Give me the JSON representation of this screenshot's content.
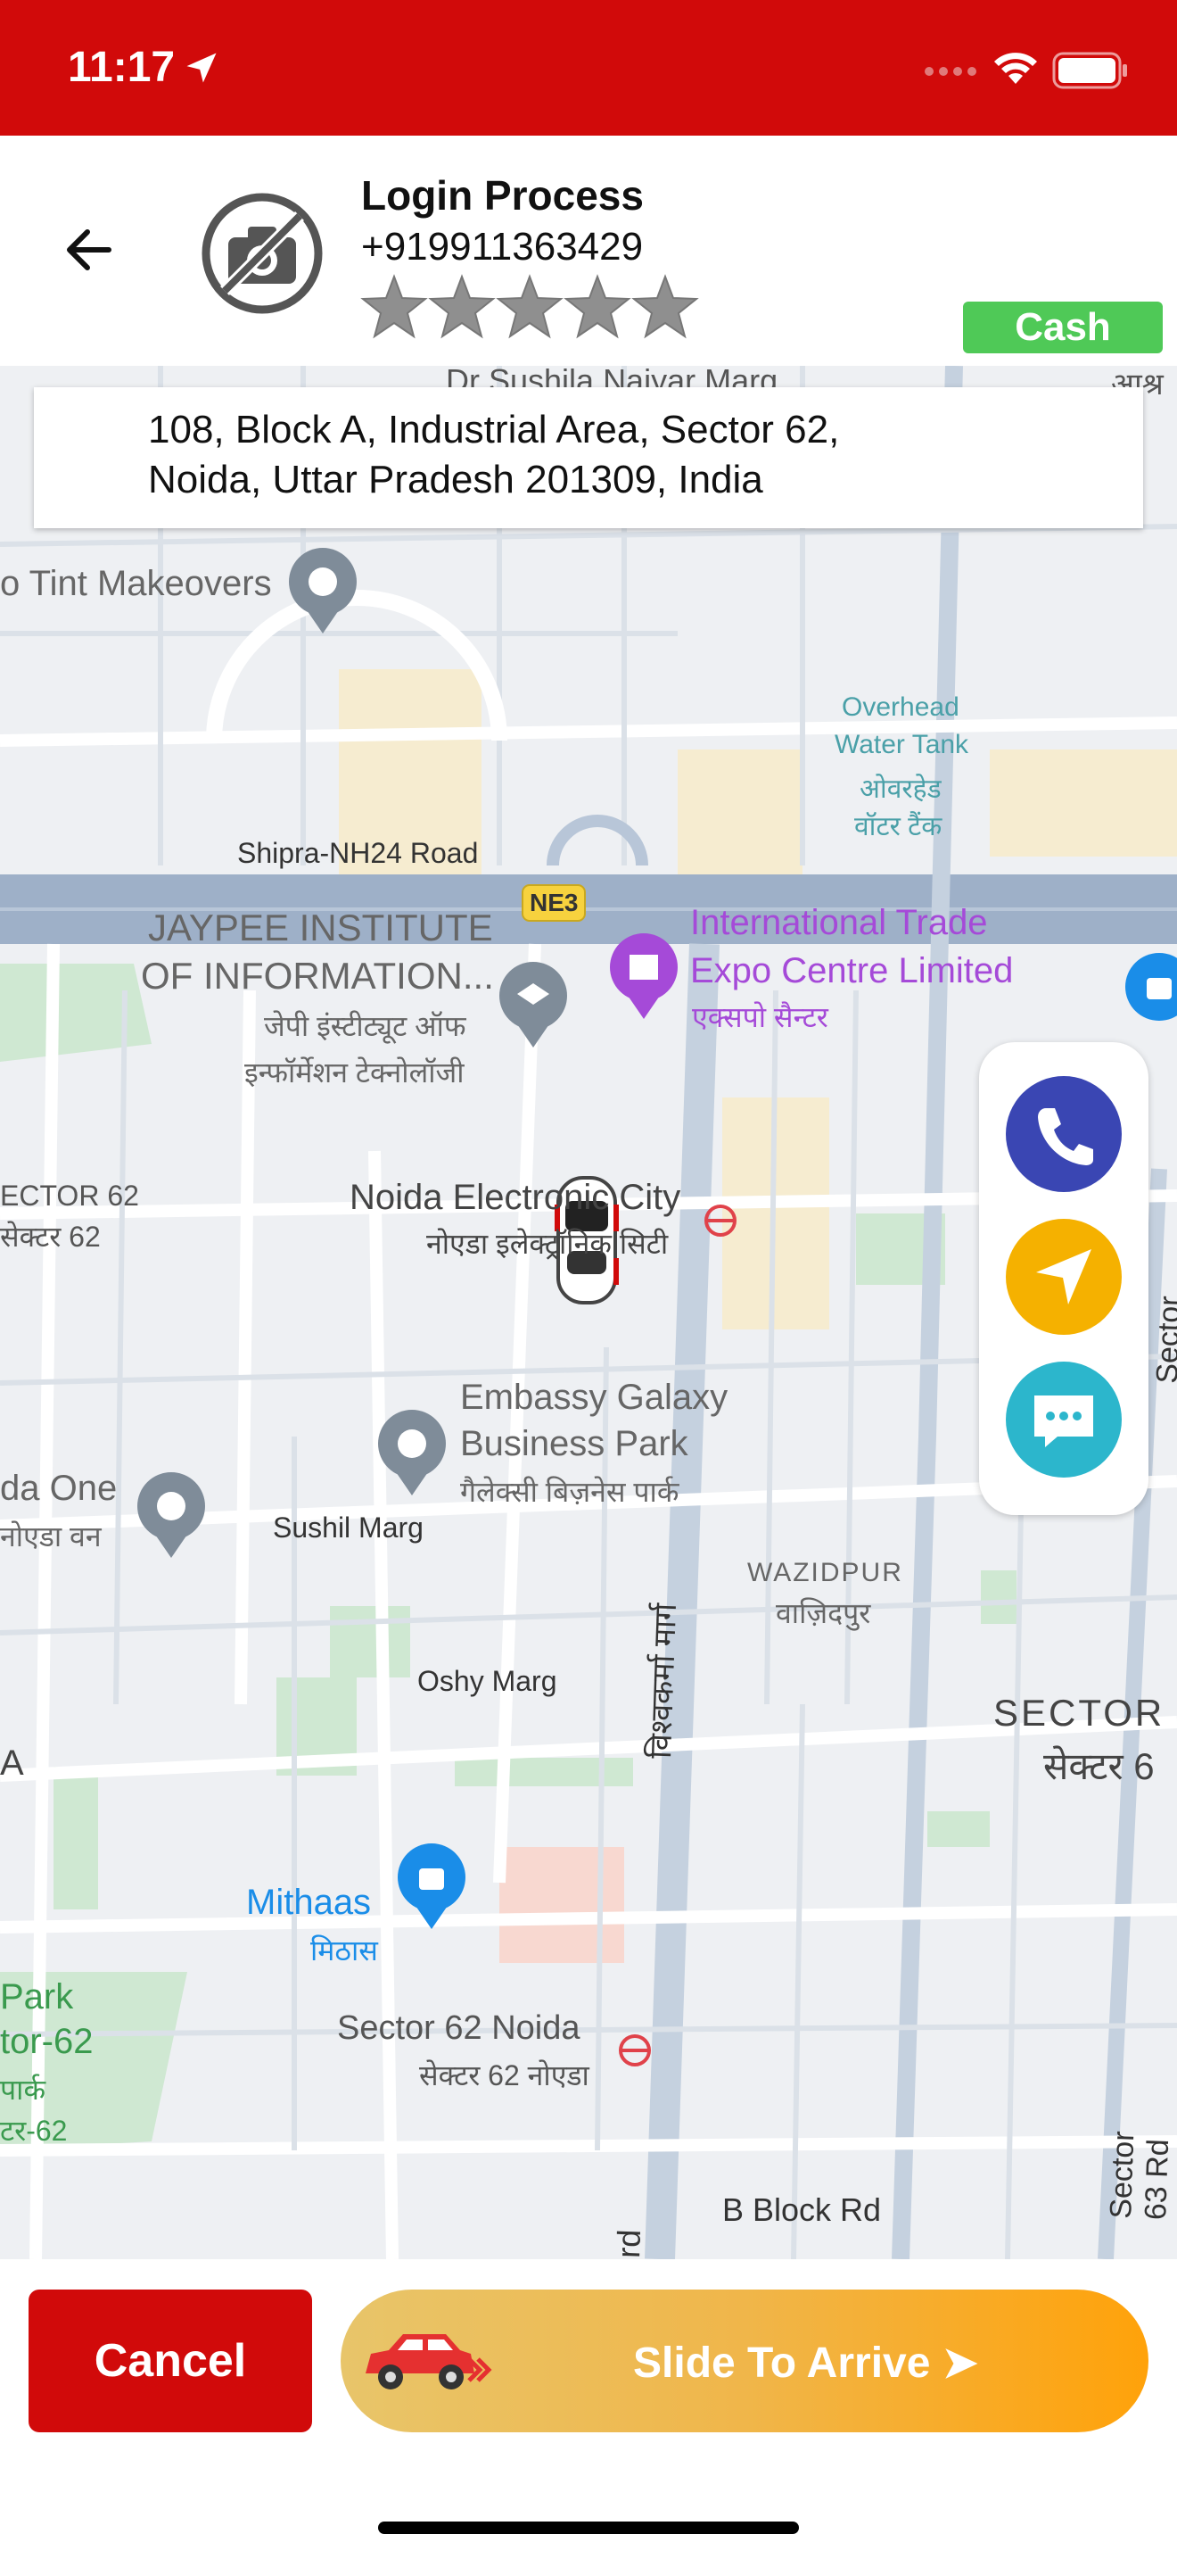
{
  "status_bar": {
    "time": "11:17"
  },
  "header": {
    "name": "Login Process",
    "phone": "+919911363429",
    "rating": 0,
    "payment_badge": "Cash"
  },
  "address": {
    "line1": "108, Block A, Industrial Area, Sector 62,",
    "line2": "Noida, Uttar Pradesh 201309, India"
  },
  "map": {
    "labels": {
      "road_top": "Dr Sushila Naiyar Marg",
      "tint": "o Tint Makeovers",
      "water1": "Overhead",
      "water2": "Water Tank",
      "water3": "ओवरहेड",
      "water4": "वॉटर टैंक",
      "shipra": "Shipra-NH24 Road",
      "ne3": "NE3",
      "jaypee1": "JAYPEE INSTITUTE",
      "jaypee2": "OF INFORMATION...",
      "jaypee3": "जेपी इंस्टीट्यूट ऑफ",
      "jaypee4": "इन्फॉर्मेशन टेक्नोलॉजी",
      "itpo1": "International Trade",
      "itpo2": "Expo Centre Limited",
      "itpo3": "एक्सपो सैन्टर",
      "sector62a": "ECTOR 62",
      "sector62b": "सेक्टर 62",
      "nec1": "Noida Electronic City",
      "nec2": "नोएडा इलेक्ट्रॉनिक सिटी",
      "embassy1": "Embassy Galaxy",
      "embassy2": "Business Park",
      "embassy3": "गैलेक्सी बिज़नेस पार्क",
      "noidaone1": "da One",
      "noidaone2": "नोएडा वन",
      "sushil": "Sushil Marg",
      "wazidpur1": "WAZIDPUR",
      "wazidpur2": "वाज़िदपुर",
      "vishwakarma": "विश्वकर्मा मार्ग",
      "oshy": "Oshy Marg",
      "sector_right1": "SECTOR",
      "sector_right2": "सेक्टर 6",
      "a_left": "A",
      "mithaas1": "Mithaas",
      "mithaas2": "मिठास",
      "park1": "Park",
      "park2": "tor-62",
      "park3": "पार्क",
      "park4": "टर-62",
      "sector62noida1": "Sector 62 Noida",
      "sector62noida2": "सेक्टर 62 नोएडा",
      "bblock": "B Block Rd",
      "sector63": "Sector 63 Rd",
      "sector63b": "Sector 63 Rd",
      "ashr": "आश्र",
      "rd": "rd"
    }
  },
  "actions": {
    "call_color": "#3a46b3",
    "navigate_color": "#f5b100",
    "chat_color": "#2cb6cc"
  },
  "footer": {
    "cancel_label": "Cancel",
    "slide_label": "Slide To Arrive ➤"
  }
}
